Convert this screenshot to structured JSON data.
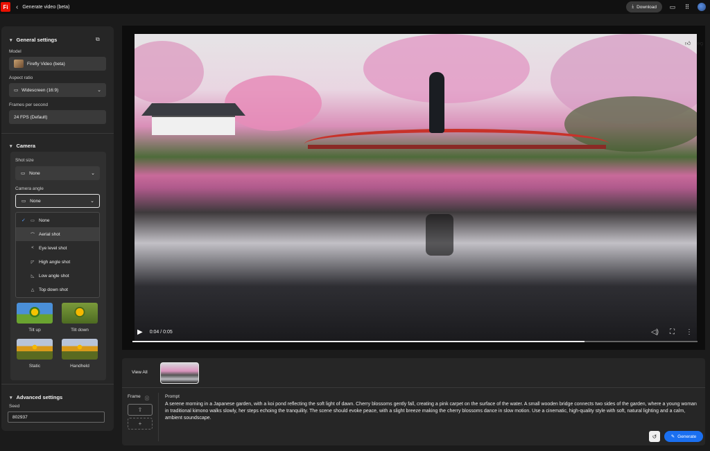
{
  "header": {
    "app_logo": "Fi",
    "title": "Generate video (beta)",
    "download_label": "Download",
    "icons": [
      "chat-icon",
      "apps-grid-icon",
      "avatar"
    ]
  },
  "general_settings": {
    "title": "General settings",
    "model_label": "Model",
    "model_value": "Firefly Video (beta)",
    "aspect_label": "Aspect ratio",
    "aspect_value": "Widescreen (16:9)",
    "fps_label": "Frames per second",
    "fps_value": "24 FPS (Default)"
  },
  "camera": {
    "title": "Camera",
    "shot_size_label": "Shot size",
    "shot_size_value": "None",
    "angle_label": "Camera angle",
    "angle_value": "None",
    "angle_options": [
      "None",
      "Aerial shot",
      "Eye level shot",
      "High angle shot",
      "Low angle shot",
      "Top down shot"
    ],
    "selected_option": "None",
    "hovered_option": "Aerial shot",
    "presets": [
      "Tilt up",
      "Tilt down",
      "Static",
      "Handheld"
    ]
  },
  "advanced": {
    "title": "Advanced settings",
    "seed_label": "Seed",
    "seed_value": "802937"
  },
  "player": {
    "time": "0:04 / 0:05",
    "progress": 0.8
  },
  "bottom": {
    "view_all": "View All",
    "frame_label": "Frame",
    "prompt_label": "Prompt",
    "prompt_text": "A serene morning in a Japanese garden, with a koi pond reflecting the soft light of dawn. Cherry blossoms gently fall, creating a pink carpet on the surface of the water. A small wooden bridge connects two sides of the garden, where a young woman in traditional kimono walks slowly, her steps echoing the tranquility. The scene should evoke peace, with a slight breeze making the cherry blossoms dance in slow motion. Use a cinematic, high-quality style with soft, natural lighting and a calm, ambient soundscape.",
    "generate_label": "Generate"
  },
  "colors": {
    "accent": "#1a6ff0",
    "app_red": "#eb1000"
  }
}
